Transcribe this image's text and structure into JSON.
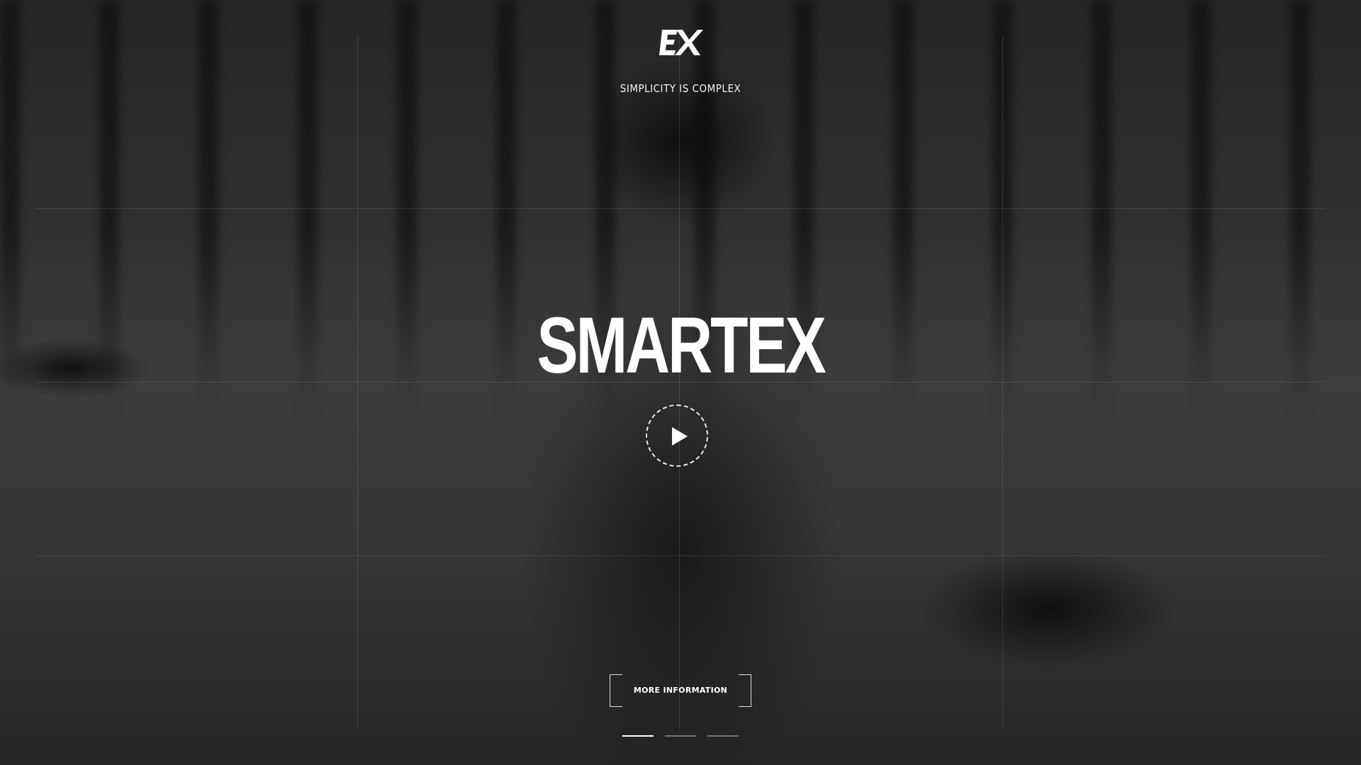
{
  "brand": {
    "logo_icon": "ex-monogram-icon",
    "tagline": "SIMPLICITY IS COMPLEX"
  },
  "hero": {
    "title": "SMARTEX",
    "play_icon": "play-icon",
    "more_button_label": "MORE INFORMATION"
  },
  "slider": {
    "count": 3,
    "active_index": 0
  },
  "colors": {
    "text": "#ffffff",
    "overlay": "#000000"
  }
}
